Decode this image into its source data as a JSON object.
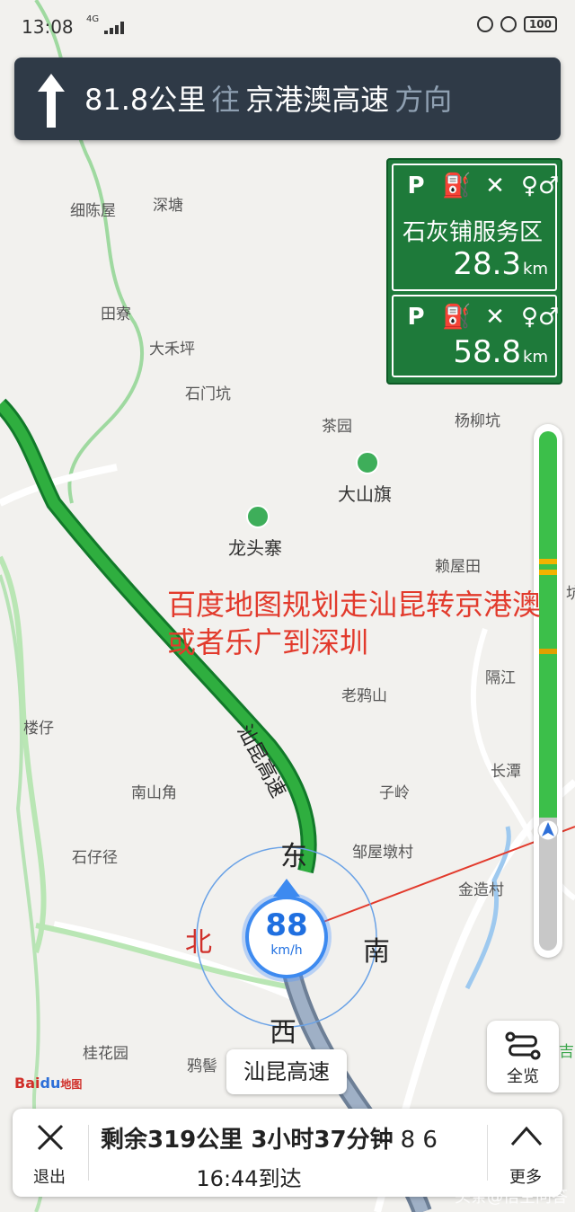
{
  "status_bar": {
    "time": "13:08",
    "network": "4G",
    "battery": "100"
  },
  "nav_banner": {
    "distance": "81.8公里",
    "prep": "往",
    "road": "京港澳高速",
    "suffix": "方向"
  },
  "service_areas": [
    {
      "amenities": [
        "P",
        "⛽",
        "✕",
        "♀♂"
      ],
      "name": "石灰铺服务区",
      "distance": "28.3",
      "unit": "km"
    },
    {
      "amenities": [
        "P",
        "⛽",
        "✕",
        "♀♂"
      ],
      "distance": "58.8",
      "unit": "km"
    }
  ],
  "map_labels": {
    "xichenwu": "细陈屋",
    "shentang": "深塘",
    "tianliao": "田寮",
    "dahuoping": "大禾坪",
    "shimenkeng": "石门坑",
    "chayuan": "茶园",
    "yangliukeng": "杨柳坑",
    "dashanqi": "大山旗",
    "longtouzhai": "龙头寨",
    "laiwutian": "赖屋田",
    "gejiang": "隔江",
    "laoyashan": "老鸦山",
    "louzai": "楼仔",
    "changtan": "长潭",
    "nanshanjiao": "南山角",
    "ziling": "子岭",
    "shizaijing": "石仔径",
    "zouwudunchun": "邹屋墩村",
    "jinzaocun": "金造村",
    "guihuayuan": "桂花园",
    "yaji": "鸦髻",
    "road_shankun": "汕昆高速",
    "edge_ke": "坑",
    "edge_jin": "吉"
  },
  "annotation": {
    "text": "百度地图规划走汕昆转京港澳或者乐广到深圳"
  },
  "compass": {
    "north": "北",
    "south": "南",
    "east": "东",
    "west": "西"
  },
  "speed": {
    "value": "88",
    "unit": "km/h"
  },
  "current_road": "汕昆高速",
  "overview_button": {
    "label": "全览"
  },
  "baidu_logo": {
    "bai": "Bai",
    "du": "du",
    "text": "地图"
  },
  "bottom_bar": {
    "exit_label": "退出",
    "remaining": "剩余319公里 3小时37分钟",
    "lights": "8 6",
    "eta": "16:44到达",
    "more_label": "更多"
  },
  "watermark": "头条@悟空问答",
  "colors": {
    "highway_green": "#2fae3f",
    "banner_bg": "#2f3a47",
    "sign_green": "#1e7a3a",
    "annotation_red": "#e23a2c",
    "speed_blue": "#1f6fe0"
  }
}
